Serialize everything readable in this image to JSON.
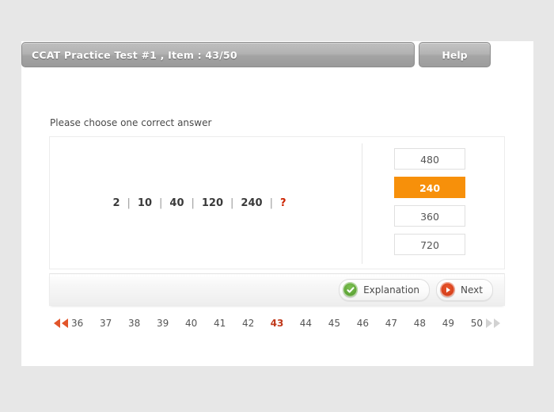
{
  "header": {
    "title": "CCAT Practice Test #1 , Item : 43/50",
    "help_label": "Help"
  },
  "instruction": "Please choose one correct answer",
  "question": {
    "sequence": [
      "2",
      "10",
      "40",
      "120",
      "240"
    ],
    "unknown": "?",
    "separator": "|"
  },
  "options": [
    {
      "label": "480",
      "selected": false
    },
    {
      "label": "240",
      "selected": true
    },
    {
      "label": "360",
      "selected": false
    },
    {
      "label": "720",
      "selected": false
    }
  ],
  "footer": {
    "explanation_label": "Explanation",
    "next_label": "Next"
  },
  "pagination": {
    "prev_icon": "double-left-arrow",
    "next_icon": "double-right-arrow",
    "pages": [
      "36",
      "37",
      "38",
      "39",
      "40",
      "41",
      "42",
      "43",
      "44",
      "45",
      "46",
      "47",
      "48",
      "49",
      "50"
    ],
    "current": "43"
  },
  "colors": {
    "accent_orange": "#f7900a",
    "current_page_red": "#c0391b",
    "arrow_red": "#e2552a",
    "arrow_disabled": "#d2d2d2"
  }
}
